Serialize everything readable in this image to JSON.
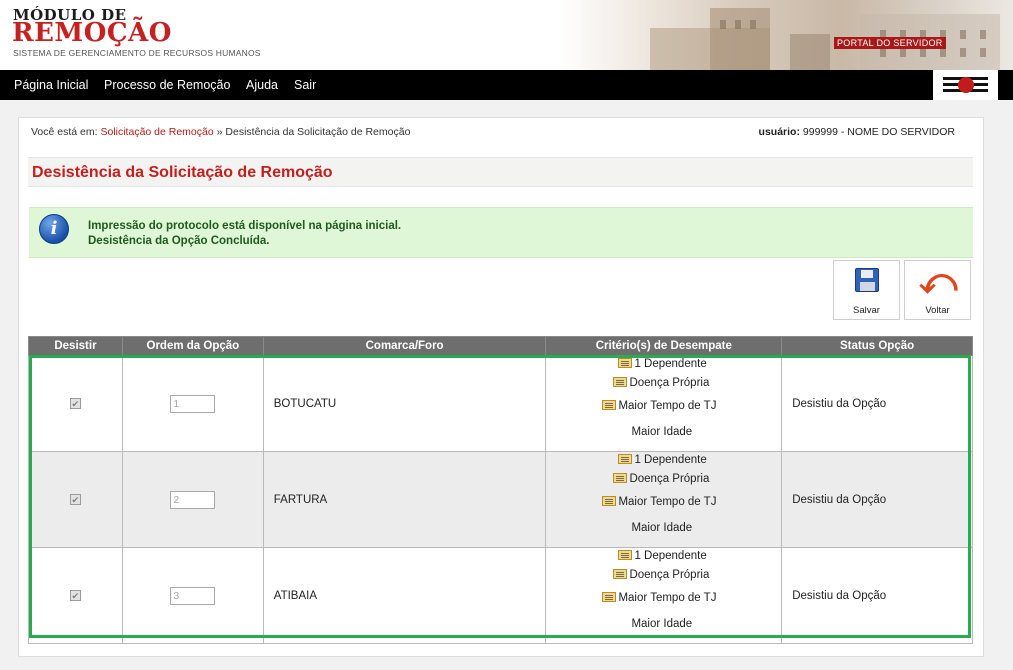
{
  "header": {
    "logo_line1": "MÓDULO DE",
    "logo_line2": "REMOÇÃO",
    "logo_subtitle": "SISTEMA DE GERENCIAMENTO DE RECURSOS HUMANOS",
    "portal_label": "PORTAL DO SERVIDOR"
  },
  "nav": {
    "items": [
      {
        "label": "Página Inicial"
      },
      {
        "label": "Processo de Remoção"
      },
      {
        "label": "Ajuda"
      },
      {
        "label": "Sair"
      }
    ]
  },
  "breadcrumb": {
    "prefix": "Você está em:",
    "link": "Solicitação de Remoção",
    "separator": "»",
    "current": "Desistência da Solicitação de Remoção"
  },
  "user": {
    "label": "usuário:",
    "value": "999999 - NOME DO SERVIDOR"
  },
  "page_title": "Desistência da Solicitação de Remoção",
  "message": {
    "line1": "Impressão do protocolo está disponível na página inicial.",
    "line2": "Desistência da Opção Concluída."
  },
  "toolbar": {
    "save_label": "Salvar",
    "back_label": "Voltar"
  },
  "table": {
    "headers": [
      "Desistir",
      "Ordem da Opção",
      "Comarca/Foro",
      "Critério(s) de Desempate",
      "Status Opção"
    ],
    "rows": [
      {
        "checked": true,
        "ordem": "1",
        "comarca": "BOTUCATU",
        "status": "Desistiu da Opção",
        "criterios": [
          "1 Dependente",
          "Doença Própria",
          "Maior Tempo de TJ",
          "Maior Idade"
        ]
      },
      {
        "checked": true,
        "ordem": "2",
        "comarca": "FARTURA",
        "status": "Desistiu da Opção",
        "criterios": [
          "1 Dependente",
          "Doença Própria",
          "Maior Tempo de TJ",
          "Maior Idade"
        ]
      },
      {
        "checked": true,
        "ordem": "3",
        "comarca": "ATIBAIA",
        "status": "Desistiu da Opção",
        "criterios": [
          "1 Dependente",
          "Doença Própria",
          "Maior Tempo de TJ",
          "Maior Idade"
        ]
      }
    ]
  },
  "colors": {
    "brand_red": "#c41e1e",
    "nav_bg": "#000000",
    "success_bg": "#dff7d6",
    "highlight_border": "#27ad4d"
  }
}
